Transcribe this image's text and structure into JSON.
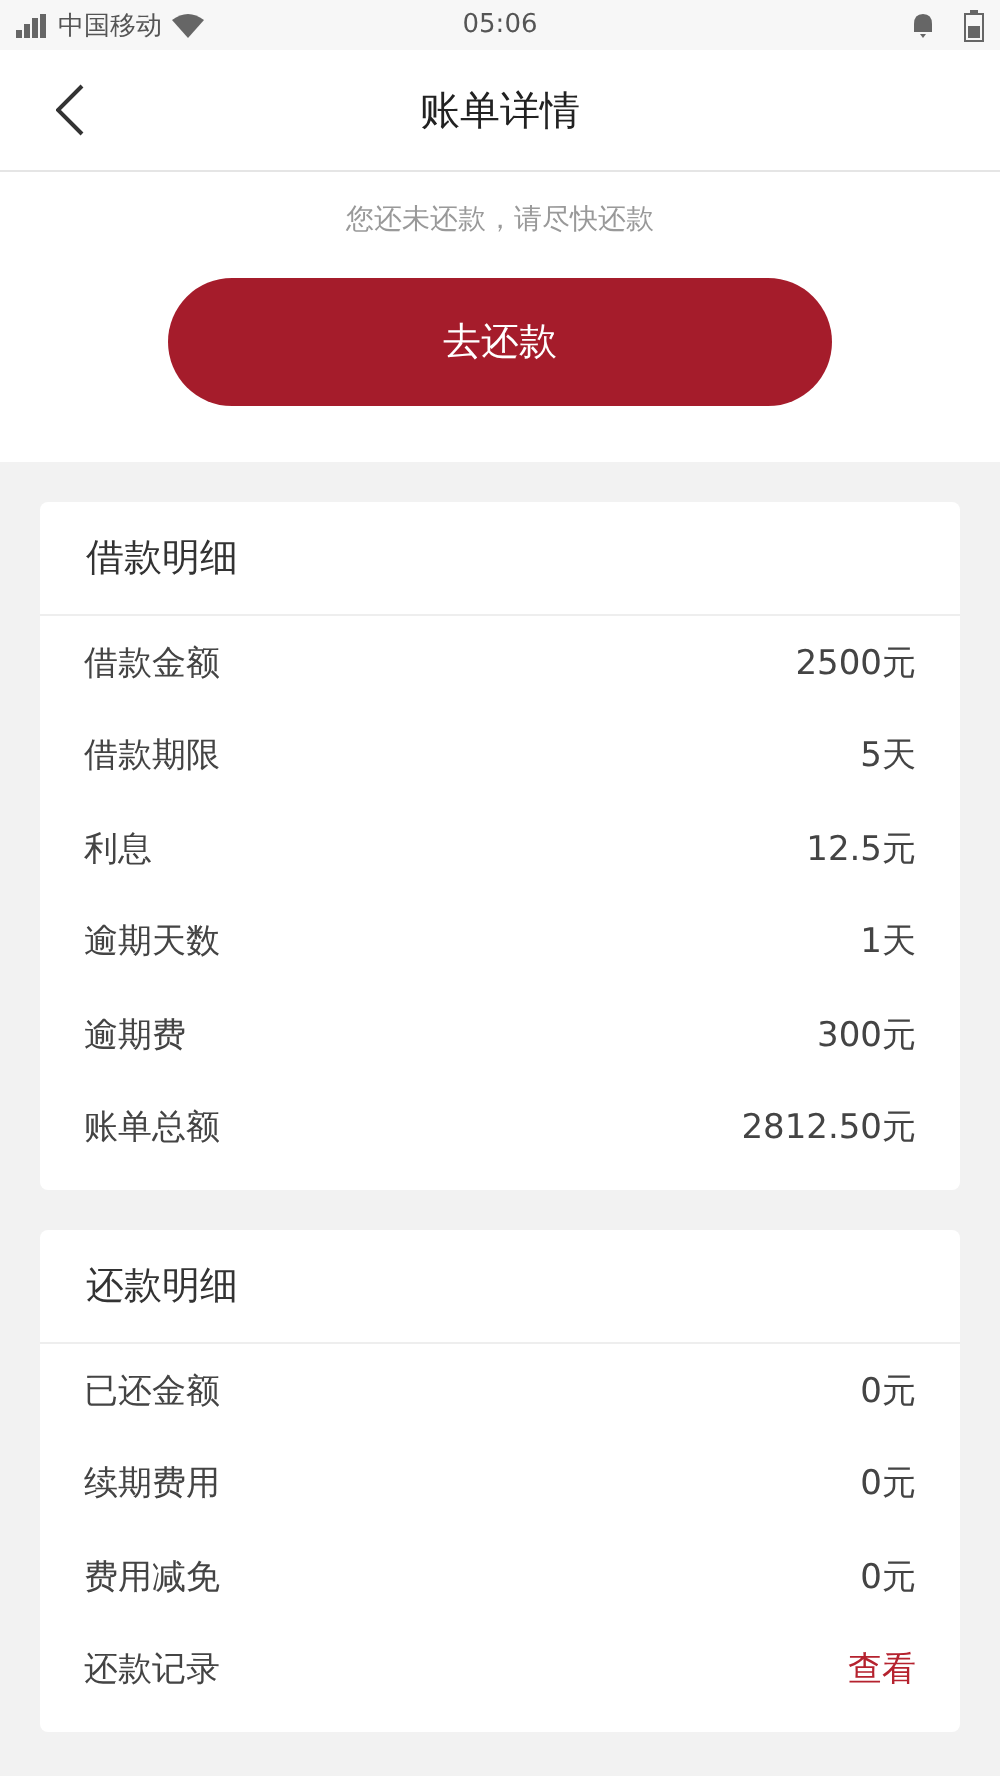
{
  "status_bar": {
    "carrier": "中国移动",
    "time": "05:06"
  },
  "header": {
    "title": "账单详情"
  },
  "notice": "您还未还款，请尽快还款",
  "repay_button": "去还款",
  "sections": [
    {
      "title": "借款明细",
      "rows": [
        {
          "label": "借款金额",
          "value": "2500元",
          "kind": "text"
        },
        {
          "label": "借款期限",
          "value": "5天",
          "kind": "text"
        },
        {
          "label": "利息",
          "value": "12.5元",
          "kind": "text"
        },
        {
          "label": "逾期天数",
          "value": "1天",
          "kind": "text"
        },
        {
          "label": "逾期费",
          "value": "300元",
          "kind": "text"
        },
        {
          "label": "账单总额",
          "value": "2812.50元",
          "kind": "text"
        }
      ]
    },
    {
      "title": "还款明细",
      "rows": [
        {
          "label": "已还金额",
          "value": "0元",
          "kind": "text"
        },
        {
          "label": "续期费用",
          "value": "0元",
          "kind": "text"
        },
        {
          "label": "费用减免",
          "value": "0元",
          "kind": "text"
        },
        {
          "label": "还款记录",
          "value": "查看",
          "kind": "link"
        }
      ]
    }
  ]
}
